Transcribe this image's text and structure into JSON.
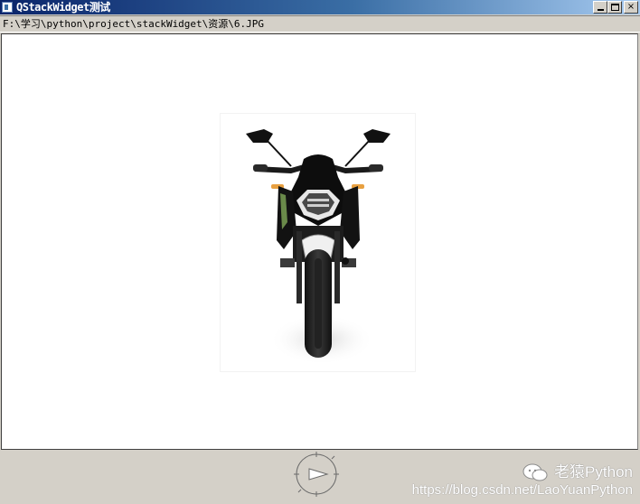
{
  "window": {
    "title": "QStackWidget测试",
    "icon": "qt-app-icon",
    "buttons": {
      "minimize": "minimize-icon",
      "maximize": "maximize-icon",
      "close": "×"
    }
  },
  "pathbar": {
    "path": "F:\\学习\\python\\project\\stackWidget\\资源\\6.JPG"
  },
  "viewer": {
    "image": "motorcycle-front-photo",
    "background": "#ffffff"
  },
  "dial": {
    "icon": "rotation-dial-icon"
  },
  "watermark": {
    "brand": "老猿Python",
    "url": "https://blog.csdn.net/LaoYuanPython",
    "logo": "wechat-logo"
  },
  "colors": {
    "titlebar_start": "#0a246a",
    "titlebar_end": "#a6caf0",
    "frame": "#d4d0c8"
  }
}
